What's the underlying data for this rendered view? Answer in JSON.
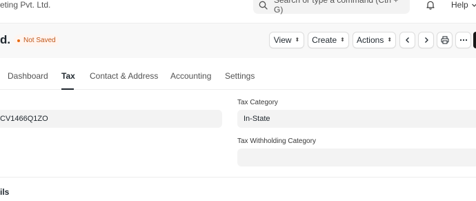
{
  "navbar": {
    "breadcrumb": "eting Pvt. Ltd.",
    "search_placeholder": "Search or type a command (Ctrl + G)",
    "help_label": "Help"
  },
  "header": {
    "title": "d.",
    "status_label": "Not Saved",
    "status_color": "#c0571a",
    "buttons": {
      "view": "View",
      "create": "Create",
      "actions": "Actions"
    }
  },
  "tabs": [
    {
      "label": "Dashboard"
    },
    {
      "label": "Tax",
      "active": true
    },
    {
      "label": "Contact & Address"
    },
    {
      "label": "Accounting"
    },
    {
      "label": "Settings"
    }
  ],
  "form": {
    "tax_id_value": "CV1466Q1ZO",
    "tax_category_label": "Tax Category",
    "tax_category_value": "In-State",
    "tax_withholding_label": "Tax Withholding Category",
    "tax_withholding_value": ""
  },
  "section": {
    "title": "ils"
  }
}
